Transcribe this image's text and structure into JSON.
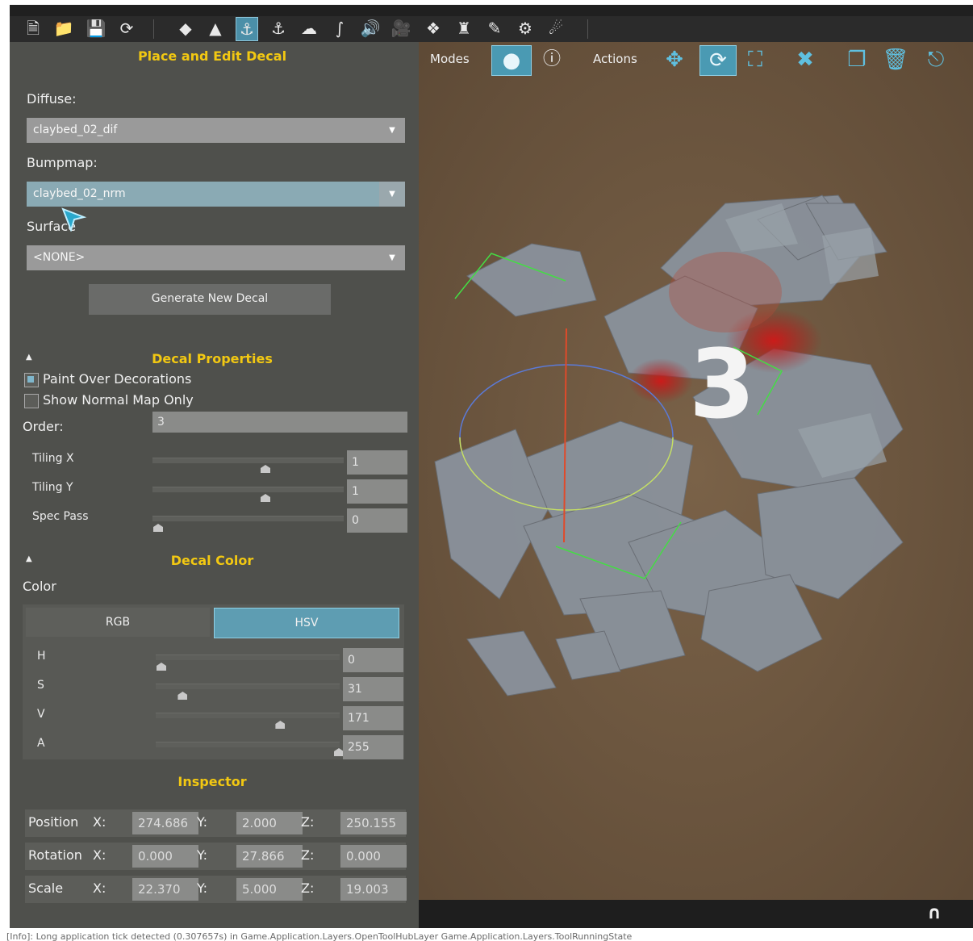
{
  "toolbar": {
    "icons": [
      "new-file-icon",
      "open-folder-icon",
      "save-icon",
      "refresh-icon",
      "terrain-icon",
      "forest-icon",
      "decal-icon",
      "decal-edit-icon",
      "cloud-icon",
      "river-icon",
      "sound-icon",
      "camera-icon",
      "mesh-icon",
      "shape-icon",
      "paint-icon",
      "gear-icon",
      "pin-icon"
    ],
    "active_index": 6
  },
  "panel": {
    "title": "Place and Edit Decal",
    "diffuse_label": "Diffuse:",
    "diffuse_value": "claybed_02_dif",
    "bumpmap_label": "Bumpmap:",
    "bumpmap_value": "claybed_02_nrm",
    "surface_label": "Surface",
    "surface_value": "<NONE>",
    "generate_button": "Generate New Decal",
    "decal_properties": {
      "title": "Decal Properties",
      "paint_over_label": "Paint Over Decorations",
      "paint_over_checked": true,
      "normal_only_label": "Show Normal Map Only",
      "normal_only_checked": false,
      "order_label": "Order:",
      "order_value": "3",
      "tiling_x_label": "Tiling X",
      "tiling_x_value": "1",
      "tiling_y_label": "Tiling Y",
      "tiling_y_value": "1",
      "spec_pass_label": "Spec Pass",
      "spec_pass_value": "0"
    },
    "decal_color": {
      "title": "Decal Color",
      "color_label": "Color",
      "tab_rgb": "RGB",
      "tab_hsv": "HSV",
      "active_tab": "HSV",
      "channels": [
        {
          "label": "H",
          "value": "0",
          "fraction": 0.0
        },
        {
          "label": "S",
          "value": "31",
          "fraction": 0.12
        },
        {
          "label": "V",
          "value": "171",
          "fraction": 0.67
        },
        {
          "label": "A",
          "value": "255",
          "fraction": 1.0
        }
      ]
    },
    "inspector": {
      "title": "Inspector",
      "rows": [
        {
          "label": "Position",
          "x": "274.686",
          "y": "2.000",
          "z": "250.155"
        },
        {
          "label": "Rotation",
          "x": "0.000",
          "y": "27.866",
          "z": "0.000"
        },
        {
          "label": "Scale",
          "x": "22.370",
          "y": "5.000",
          "z": "19.003"
        }
      ],
      "x_label": "X:",
      "y_label": "Y:",
      "z_label": "Z:"
    }
  },
  "viewport": {
    "modes_label": "Modes",
    "actions_label": "Actions",
    "decal_number": "3",
    "tools": [
      "decal-mode-icon",
      "info-icon",
      "move-icon",
      "rotate-icon",
      "scale-icon",
      "delete-decal-icon",
      "duplicate-icon",
      "trash-icon",
      "snap-to-ground-icon"
    ],
    "active_tools": [
      "decal-mode-icon",
      "rotate-icon"
    ]
  },
  "status": {
    "magnet_icon": "magnet-icon",
    "log": "[Info]: Long application tick detected (0.307657s) in Game.Application.Layers.OpenToolHubLayer Game.Application.Layers.ToolRunningState"
  }
}
